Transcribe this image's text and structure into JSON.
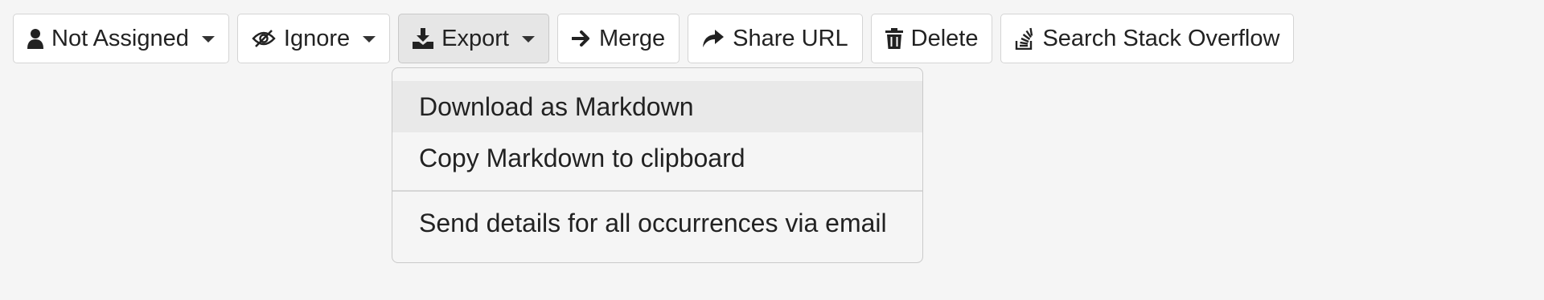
{
  "toolbar": {
    "assign": {
      "label": "Not Assigned",
      "icon": "user-icon"
    },
    "ignore": {
      "label": "Ignore",
      "icon": "eye-slash-icon"
    },
    "export": {
      "label": "Export",
      "icon": "download-icon"
    },
    "merge": {
      "label": "Merge",
      "icon": "arrow-right-icon"
    },
    "share": {
      "label": "Share URL",
      "icon": "share-icon"
    },
    "delete": {
      "label": "Delete",
      "icon": "trash-icon"
    },
    "search_so": {
      "label": "Search Stack Overflow",
      "icon": "stack-overflow-icon"
    }
  },
  "export_menu": {
    "items": [
      {
        "label": "Download as Markdown"
      },
      {
        "label": "Copy Markdown to clipboard"
      },
      {
        "label": "Send details for all occurrences via email"
      }
    ]
  }
}
